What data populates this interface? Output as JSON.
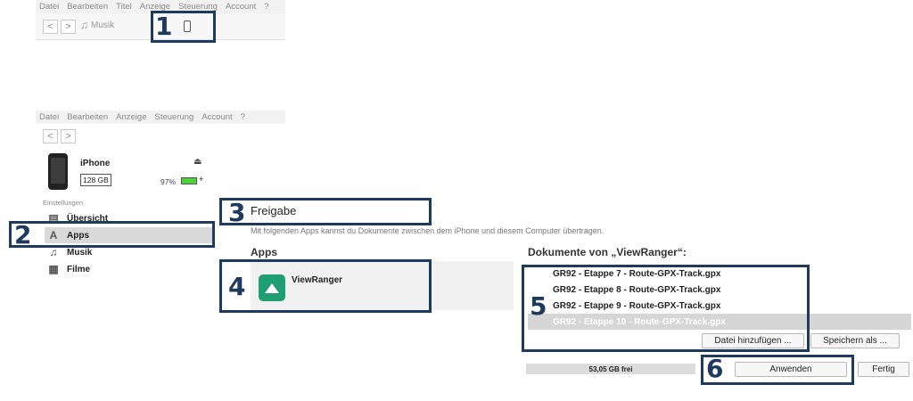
{
  "menu_top": [
    "Datei",
    "Bearbeiten",
    "Titel",
    "Anzeige",
    "Steuerung",
    "Account",
    "?"
  ],
  "menu_bottom": [
    "Datei",
    "Bearbeiten",
    "Anzeige",
    "Steuerung",
    "Account",
    "?"
  ],
  "toolbar": {
    "back": "<",
    "forward": ">",
    "library": "Musik",
    "music_icon": "music-note",
    "device_icon": "iphone-icon"
  },
  "callouts": [
    "1",
    "2",
    "3",
    "4",
    "5",
    "6"
  ],
  "device": {
    "name": "iPhone",
    "capacity": "128 GB",
    "battery_percent": "97%",
    "battery_level": 0.97,
    "eject_glyph": "⏏",
    "charging_glyph": "+"
  },
  "sidebar": {
    "section_label": "Einstellungen",
    "items": [
      {
        "label": "Übersicht",
        "icon": "summary-icon"
      },
      {
        "label": "Apps",
        "icon": "apps-icon"
      },
      {
        "label": "Musik",
        "icon": "music-icon"
      },
      {
        "label": "Filme",
        "icon": "film-icon"
      }
    ]
  },
  "main": {
    "title": "Freigabe",
    "description": "Mit folgenden Apps kannst du Dokumente zwischen dem iPhone und diesem Computer übertragen.",
    "apps_header": "Apps",
    "apps": [
      {
        "name": "ViewRanger",
        "icon_color": "#1f9e73"
      }
    ],
    "documents_header": "Dokumente von „ViewRanger“:",
    "documents": [
      "GR92 - Etappe 7 - Route-GPX-Track.gpx",
      "GR92 - Etappe 8 - Route-GPX-Track.gpx",
      "GR92 - Etappe 9 - Route-GPX-Track.gpx",
      "GR92 - Etappe 10 - Route-GPX-Track.gpx"
    ],
    "add_file_button": "Datei hinzufügen ...",
    "save_as_button": "Speichern als ..."
  },
  "footer": {
    "free_space": "53,05 GB frei",
    "apply_button": "Anwenden",
    "done_button": "Fertig"
  },
  "colors": {
    "callout": "#1e3a5f",
    "app_icon": "#1f9e73",
    "battery": "#4cd136"
  }
}
